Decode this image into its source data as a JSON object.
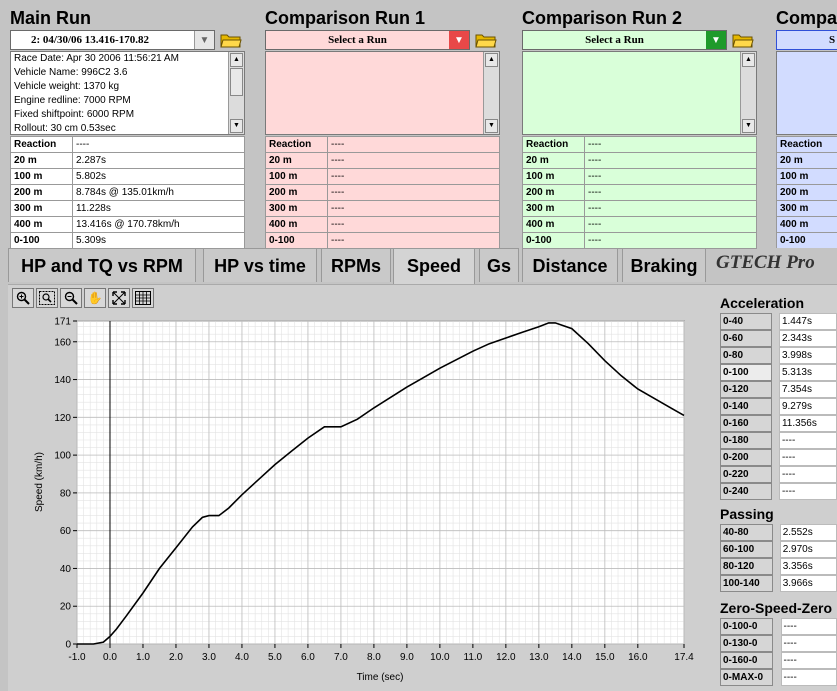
{
  "main_run": {
    "title": "Main Run",
    "selector": "2:  04/30/06 13.416-170.82",
    "info_lines": [
      "Race Date: Apr 30 2006  11:56:21 AM",
      "Vehicle Name: 996C2 3.6",
      "Vehicle weight: 1370 kg",
      "Engine redline: 7000 RPM",
      "Fixed shiftpoint: 6000 RPM",
      "Rollout: 30 cm  0.53sec"
    ],
    "stats": [
      {
        "key": "Reaction",
        "value": "----"
      },
      {
        "key": "20 m",
        "value": "2.287s"
      },
      {
        "key": "100 m",
        "value": "5.802s"
      },
      {
        "key": "200 m",
        "value": "8.784s @ 135.01km/h"
      },
      {
        "key": "300 m",
        "value": "11.228s"
      },
      {
        "key": "400 m",
        "value": "13.416s @ 170.78km/h"
      },
      {
        "key": "0-100",
        "value": "5.309s"
      }
    ]
  },
  "comparison_runs": [
    {
      "title": "Comparison Run 1",
      "selector": "Select a Run",
      "stats": [
        {
          "key": "Reaction",
          "value": "----"
        },
        {
          "key": "20 m",
          "value": "----"
        },
        {
          "key": "100 m",
          "value": "----"
        },
        {
          "key": "200 m",
          "value": "----"
        },
        {
          "key": "300 m",
          "value": "----"
        },
        {
          "key": "400 m",
          "value": "----"
        },
        {
          "key": "0-100",
          "value": "----"
        }
      ]
    },
    {
      "title": "Comparison Run 2",
      "selector": "Select a Run",
      "stats": [
        {
          "key": "Reaction",
          "value": "----"
        },
        {
          "key": "20 m",
          "value": "----"
        },
        {
          "key": "100 m",
          "value": "----"
        },
        {
          "key": "200 m",
          "value": "----"
        },
        {
          "key": "300 m",
          "value": "----"
        },
        {
          "key": "400 m",
          "value": "----"
        },
        {
          "key": "0-100",
          "value": "----"
        }
      ]
    },
    {
      "title": "Compa",
      "selector": "S",
      "stats": [
        {
          "key": "Reaction",
          "value": ""
        },
        {
          "key": "20 m",
          "value": ""
        },
        {
          "key": "100 m",
          "value": ""
        },
        {
          "key": "200 m",
          "value": ""
        },
        {
          "key": "300 m",
          "value": ""
        },
        {
          "key": "400 m",
          "value": ""
        },
        {
          "key": "0-100",
          "value": ""
        }
      ]
    }
  ],
  "tabs": [
    "HP and TQ vs RPM",
    "HP vs time",
    "RPMs",
    "Speed",
    "Gs",
    "Distance",
    "Braking"
  ],
  "active_tab": "Speed",
  "logo_text": "GTECH Pro",
  "toolbar_icons": [
    "zoom-in-icon",
    "zoom-box-icon",
    "zoom-out-icon",
    "pan-hand-icon",
    "fit-icon",
    "grid-icon"
  ],
  "acceleration": {
    "title": "Acceleration",
    "rows": [
      {
        "key": "0-40",
        "value": "1.447s"
      },
      {
        "key": "0-60",
        "value": "2.343s"
      },
      {
        "key": "0-80",
        "value": "3.998s"
      },
      {
        "key": "0-100",
        "value": "5.313s"
      },
      {
        "key": "0-120",
        "value": "7.354s"
      },
      {
        "key": "0-140",
        "value": "9.279s"
      },
      {
        "key": "0-160",
        "value": "11.356s"
      },
      {
        "key": "0-180",
        "value": "----"
      },
      {
        "key": "0-200",
        "value": "----"
      },
      {
        "key": "0-220",
        "value": "----"
      },
      {
        "key": "0-240",
        "value": "----"
      }
    ]
  },
  "passing": {
    "title": "Passing",
    "rows": [
      {
        "key": "40-80",
        "value": "2.552s"
      },
      {
        "key": "60-100",
        "value": "2.970s"
      },
      {
        "key": "80-120",
        "value": "3.356s"
      },
      {
        "key": "100-140",
        "value": "3.966s"
      }
    ]
  },
  "zero_speed_zero": {
    "title": "Zero-Speed-Zero",
    "rows": [
      {
        "key": "0-100-0",
        "value": "----"
      },
      {
        "key": "0-130-0",
        "value": "----"
      },
      {
        "key": "0-160-0",
        "value": "----"
      },
      {
        "key": "0-MAX-0",
        "value": "----"
      }
    ]
  },
  "colors": {
    "main_bg": "#ffffff",
    "comp1": "#ffd9d9",
    "comp1_accent": "#e84848",
    "comp2": "#d9ffd9",
    "comp2_accent": "#1f9a2a",
    "comp3": "#d2dcff",
    "comp3_accent": "#3050d8",
    "trace": "#000000"
  },
  "chart_data": {
    "type": "line",
    "title": "",
    "xlabel": "Time (sec)",
    "ylabel": "Speed (km/h)",
    "xlim": [
      -1.0,
      17.4
    ],
    "ylim": [
      0,
      171
    ],
    "xticks": [
      -1.0,
      0.0,
      1.0,
      2.0,
      3.0,
      4.0,
      5.0,
      6.0,
      7.0,
      8.0,
      9.0,
      10.0,
      11.0,
      12.0,
      13.0,
      14.0,
      15.0,
      16.0,
      17.4
    ],
    "yticks": [
      0,
      20,
      40,
      60,
      80,
      100,
      120,
      140,
      160,
      171
    ],
    "grid": true,
    "marker_x": 0.0,
    "series": [
      {
        "x": [
          -1.0,
          -0.5,
          -0.2,
          0.0,
          0.2,
          0.5,
          1.0,
          1.5,
          2.0,
          2.5,
          2.8,
          3.0,
          3.3,
          3.6,
          4.0,
          4.5,
          5.0,
          5.5,
          6.0,
          6.5,
          6.8,
          7.0,
          7.5,
          8.0,
          9.0,
          10.0,
          11.0,
          11.5,
          12.0,
          12.5,
          13.0,
          13.3,
          13.5,
          14.0,
          14.5,
          15.0,
          15.5,
          16.0,
          16.5,
          17.0,
          17.4
        ],
        "y": [
          0,
          0,
          1,
          4,
          8,
          15,
          27,
          40,
          51,
          62,
          67,
          68,
          68,
          72,
          79,
          87,
          95,
          102,
          109,
          115,
          115,
          115,
          119,
          125,
          136,
          146,
          155,
          159,
          162,
          165,
          168,
          170,
          170,
          167,
          159,
          150,
          142,
          135,
          130,
          125,
          121
        ]
      }
    ]
  }
}
